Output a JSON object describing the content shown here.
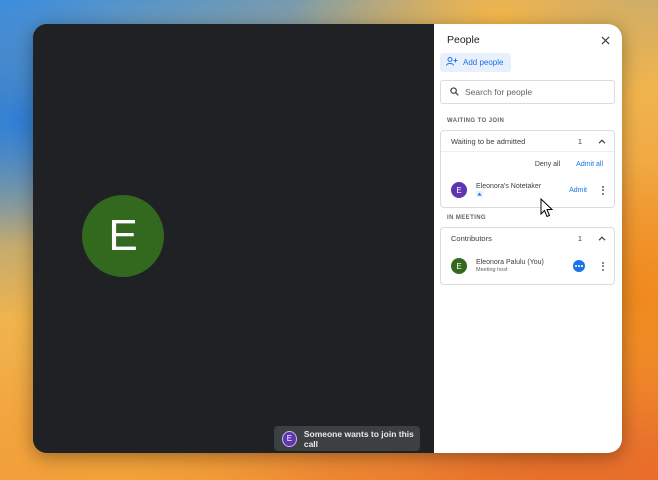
{
  "stage": {
    "avatar_letter": "E",
    "avatar_color": "#33691e"
  },
  "toast": {
    "avatar_letter": "E",
    "text": "Someone wants to join this call"
  },
  "panel": {
    "title": "People",
    "add_people_label": "Add people",
    "search_placeholder": "Search for people",
    "waiting_section_label": "WAITING TO JOIN",
    "waiting_card": {
      "header": "Waiting to be admitted",
      "count": "1",
      "deny_all_label": "Deny all",
      "admit_all_label": "Admit all",
      "person": {
        "avatar_letter": "E",
        "avatar_color": "#5e35b1",
        "name": "Eleonora's Notetaker",
        "admit_label": "Admit"
      }
    },
    "in_meeting_section_label": "IN MEETING",
    "contributors_card": {
      "header": "Contributors",
      "count": "1",
      "person": {
        "avatar_letter": "E",
        "avatar_color": "#33691e",
        "name": "Eleonora Palulu (You)",
        "role": "Meeting host"
      }
    }
  },
  "icons": [
    "close-icon",
    "add-person-icon",
    "search-icon",
    "chevron-up-icon",
    "more-vert-icon",
    "more-horiz-icon",
    "notetaker-icon",
    "mouse-cursor-icon"
  ]
}
